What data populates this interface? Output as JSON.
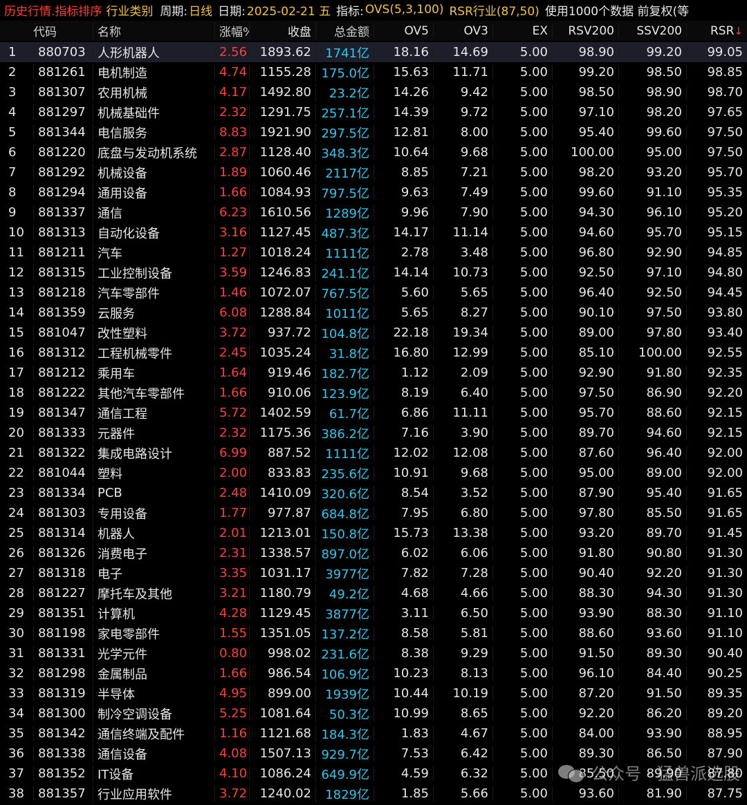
{
  "topbar": {
    "title": "历史行情.指标排序",
    "category": "行业类别",
    "period_label": "周期:",
    "period_value": "日线",
    "date_label": "日期:",
    "date_value": "2025-02-21 五",
    "indicator_label": "指标:",
    "indicator_value": "OVS(5,3,100)",
    "indicator_value2": "RSR行业(87,50)",
    "extra": "使用1000个数据 前复权(等"
  },
  "columns": {
    "code": "代码",
    "name": "名称",
    "change": "涨幅%",
    "close": "收盘",
    "amount": "总金额",
    "ov5": "OV5",
    "ov3": "OV3",
    "ex": "EX",
    "rsv200": "RSV200",
    "ssv200": "SSV200",
    "rsr": "RSR",
    "rsr_sort": "↓"
  },
  "rows": [
    {
      "no": "1",
      "code": "880703",
      "name": "人形机器人",
      "change": "2.56",
      "close": "1893.62",
      "amount": "1741亿",
      "ov5": "18.16",
      "ov3": "14.69",
      "ex": "5.00",
      "rsv": "98.90",
      "ssv": "99.20",
      "rsr": "99.05"
    },
    {
      "no": "2",
      "code": "881261",
      "name": "电机制造",
      "change": "4.74",
      "close": "1155.28",
      "amount": "175.0亿",
      "ov5": "15.63",
      "ov3": "11.71",
      "ex": "5.00",
      "rsv": "99.20",
      "ssv": "98.50",
      "rsr": "98.85"
    },
    {
      "no": "3",
      "code": "881307",
      "name": "农用机械",
      "change": "4.17",
      "close": "1492.80",
      "amount": "23.2亿",
      "ov5": "14.26",
      "ov3": "9.42",
      "ex": "5.00",
      "rsv": "98.50",
      "ssv": "98.90",
      "rsr": "98.70"
    },
    {
      "no": "4",
      "code": "881297",
      "name": "机械基础件",
      "change": "2.32",
      "close": "1291.75",
      "amount": "257.1亿",
      "ov5": "14.39",
      "ov3": "9.72",
      "ex": "5.00",
      "rsv": "97.10",
      "ssv": "98.20",
      "rsr": "97.65"
    },
    {
      "no": "5",
      "code": "881344",
      "name": "电信服务",
      "change": "8.83",
      "close": "1921.90",
      "amount": "297.5亿",
      "ov5": "12.81",
      "ov3": "8.00",
      "ex": "5.00",
      "rsv": "95.40",
      "ssv": "99.60",
      "rsr": "97.50"
    },
    {
      "no": "6",
      "code": "881220",
      "name": "底盘与发动机系统",
      "change": "2.87",
      "close": "1128.40",
      "amount": "348.3亿",
      "ov5": "10.64",
      "ov3": "9.68",
      "ex": "5.00",
      "rsv": "100.00",
      "ssv": "95.00",
      "rsr": "97.50"
    },
    {
      "no": "7",
      "code": "881292",
      "name": "机械设备",
      "change": "1.89",
      "close": "1060.46",
      "amount": "2117亿",
      "ov5": "8.85",
      "ov3": "7.21",
      "ex": "5.00",
      "rsv": "98.20",
      "ssv": "93.20",
      "rsr": "95.70"
    },
    {
      "no": "8",
      "code": "881294",
      "name": "通用设备",
      "change": "1.66",
      "close": "1084.93",
      "amount": "797.5亿",
      "ov5": "9.63",
      "ov3": "7.49",
      "ex": "5.00",
      "rsv": "99.60",
      "ssv": "91.10",
      "rsr": "95.35"
    },
    {
      "no": "9",
      "code": "881337",
      "name": "通信",
      "change": "6.23",
      "close": "1610.56",
      "amount": "1289亿",
      "ov5": "9.96",
      "ov3": "7.90",
      "ex": "5.00",
      "rsv": "94.30",
      "ssv": "96.10",
      "rsr": "95.20"
    },
    {
      "no": "10",
      "code": "881313",
      "name": "自动化设备",
      "change": "3.16",
      "close": "1127.45",
      "amount": "487.3亿",
      "ov5": "14.17",
      "ov3": "11.14",
      "ex": "5.00",
      "rsv": "94.60",
      "ssv": "95.70",
      "rsr": "95.15"
    },
    {
      "no": "11",
      "code": "881211",
      "name": "汽车",
      "change": "1.27",
      "close": "1018.24",
      "amount": "1111亿",
      "ov5": "2.78",
      "ov3": "3.48",
      "ex": "5.00",
      "rsv": "96.80",
      "ssv": "92.90",
      "rsr": "94.85"
    },
    {
      "no": "12",
      "code": "881315",
      "name": "工业控制设备",
      "change": "3.59",
      "close": "1246.83",
      "amount": "241.1亿",
      "ov5": "14.14",
      "ov3": "10.73",
      "ex": "5.00",
      "rsv": "92.50",
      "ssv": "97.10",
      "rsr": "94.80"
    },
    {
      "no": "13",
      "code": "881218",
      "name": "汽车零部件",
      "change": "1.46",
      "close": "1072.07",
      "amount": "767.5亿",
      "ov5": "5.60",
      "ov3": "5.65",
      "ex": "5.00",
      "rsv": "96.40",
      "ssv": "92.50",
      "rsr": "94.45"
    },
    {
      "no": "14",
      "code": "881359",
      "name": "云服务",
      "change": "6.08",
      "close": "1288.84",
      "amount": "1011亿",
      "ov5": "5.65",
      "ov3": "8.27",
      "ex": "5.00",
      "rsv": "90.10",
      "ssv": "97.50",
      "rsr": "93.80"
    },
    {
      "no": "15",
      "code": "881047",
      "name": "改性塑料",
      "change": "3.72",
      "close": "937.72",
      "amount": "104.8亿",
      "ov5": "22.18",
      "ov3": "19.34",
      "ex": "5.00",
      "rsv": "89.00",
      "ssv": "97.80",
      "rsr": "93.40"
    },
    {
      "no": "16",
      "code": "881312",
      "name": "工程机械零件",
      "change": "2.45",
      "close": "1035.24",
      "amount": "31.8亿",
      "ov5": "16.80",
      "ov3": "12.99",
      "ex": "5.00",
      "rsv": "85.10",
      "ssv": "100.00",
      "rsr": "92.55"
    },
    {
      "no": "17",
      "code": "881212",
      "name": "乘用车",
      "change": "1.64",
      "close": "919.46",
      "amount": "182.7亿",
      "ov5": "1.12",
      "ov3": "2.09",
      "ex": "5.00",
      "rsv": "92.90",
      "ssv": "91.80",
      "rsr": "92.35"
    },
    {
      "no": "18",
      "code": "881222",
      "name": "其他汽车零部件",
      "change": "1.66",
      "close": "910.06",
      "amount": "123.9亿",
      "ov5": "8.19",
      "ov3": "6.40",
      "ex": "5.00",
      "rsv": "97.50",
      "ssv": "86.90",
      "rsr": "92.20"
    },
    {
      "no": "19",
      "code": "881347",
      "name": "通信工程",
      "change": "5.72",
      "close": "1402.59",
      "amount": "61.7亿",
      "ov5": "6.86",
      "ov3": "11.11",
      "ex": "5.00",
      "rsv": "95.70",
      "ssv": "88.60",
      "rsr": "92.15"
    },
    {
      "no": "20",
      "code": "881333",
      "name": "元器件",
      "change": "2.32",
      "close": "1175.36",
      "amount": "386.2亿",
      "ov5": "7.16",
      "ov3": "3.90",
      "ex": "5.00",
      "rsv": "89.70",
      "ssv": "94.60",
      "rsr": "92.15"
    },
    {
      "no": "21",
      "code": "881322",
      "name": "集成电路设计",
      "change": "6.99",
      "close": "887.52",
      "amount": "1111亿",
      "ov5": "12.02",
      "ov3": "12.08",
      "ex": "5.00",
      "rsv": "87.60",
      "ssv": "96.40",
      "rsr": "92.00"
    },
    {
      "no": "22",
      "code": "881044",
      "name": "塑料",
      "change": "2.00",
      "close": "833.83",
      "amount": "235.6亿",
      "ov5": "10.91",
      "ov3": "9.68",
      "ex": "5.00",
      "rsv": "95.00",
      "ssv": "89.00",
      "rsr": "92.00"
    },
    {
      "no": "23",
      "code": "881334",
      "name": "PCB",
      "change": "2.48",
      "close": "1410.09",
      "amount": "320.6亿",
      "ov5": "8.54",
      "ov3": "3.52",
      "ex": "5.00",
      "rsv": "87.90",
      "ssv": "95.40",
      "rsr": "91.65"
    },
    {
      "no": "24",
      "code": "881303",
      "name": "专用设备",
      "change": "1.77",
      "close": "977.87",
      "amount": "684.8亿",
      "ov5": "7.95",
      "ov3": "6.80",
      "ex": "5.00",
      "rsv": "97.80",
      "ssv": "85.50",
      "rsr": "91.65"
    },
    {
      "no": "25",
      "code": "881314",
      "name": "机器人",
      "change": "2.01",
      "close": "1213.01",
      "amount": "150.8亿",
      "ov5": "15.73",
      "ov3": "13.38",
      "ex": "5.00",
      "rsv": "93.20",
      "ssv": "89.70",
      "rsr": "91.45"
    },
    {
      "no": "26",
      "code": "881326",
      "name": "消费电子",
      "change": "2.31",
      "close": "1338.57",
      "amount": "897.0亿",
      "ov5": "6.02",
      "ov3": "6.06",
      "ex": "5.00",
      "rsv": "91.80",
      "ssv": "90.80",
      "rsr": "91.30"
    },
    {
      "no": "27",
      "code": "881318",
      "name": "电子",
      "change": "3.35",
      "close": "1031.17",
      "amount": "3977亿",
      "ov5": "7.82",
      "ov3": "7.28",
      "ex": "5.00",
      "rsv": "90.40",
      "ssv": "92.20",
      "rsr": "91.30"
    },
    {
      "no": "28",
      "code": "881227",
      "name": "摩托车及其他",
      "change": "3.21",
      "close": "1180.79",
      "amount": "49.2亿",
      "ov5": "4.68",
      "ov3": "4.66",
      "ex": "5.00",
      "rsv": "88.30",
      "ssv": "94.30",
      "rsr": "91.30"
    },
    {
      "no": "29",
      "code": "881351",
      "name": "计算机",
      "change": "4.28",
      "close": "1129.45",
      "amount": "3877亿",
      "ov5": "3.11",
      "ov3": "6.50",
      "ex": "5.00",
      "rsv": "93.90",
      "ssv": "88.30",
      "rsr": "91.10"
    },
    {
      "no": "30",
      "code": "881198",
      "name": "家电零部件",
      "change": "1.55",
      "close": "1351.05",
      "amount": "137.2亿",
      "ov5": "8.58",
      "ov3": "5.81",
      "ex": "5.00",
      "rsv": "88.60",
      "ssv": "93.60",
      "rsr": "91.10"
    },
    {
      "no": "31",
      "code": "881331",
      "name": "光学元件",
      "change": "0.80",
      "close": "998.02",
      "amount": "231.6亿",
      "ov5": "8.38",
      "ov3": "9.29",
      "ex": "5.00",
      "rsv": "91.50",
      "ssv": "89.30",
      "rsr": "90.40"
    },
    {
      "no": "32",
      "code": "881298",
      "name": "金属制品",
      "change": "1.66",
      "close": "986.54",
      "amount": "106.9亿",
      "ov5": "10.23",
      "ov3": "8.13",
      "ex": "5.00",
      "rsv": "96.10",
      "ssv": "84.40",
      "rsr": "90.25"
    },
    {
      "no": "33",
      "code": "881319",
      "name": "半导体",
      "change": "4.95",
      "close": "899.00",
      "amount": "1939亿",
      "ov5": "10.44",
      "ov3": "10.19",
      "ex": "5.00",
      "rsv": "87.20",
      "ssv": "91.50",
      "rsr": "89.35"
    },
    {
      "no": "34",
      "code": "881300",
      "name": "制冷空调设备",
      "change": "5.25",
      "close": "1081.64",
      "amount": "50.3亿",
      "ov5": "10.99",
      "ov3": "8.65",
      "ex": "5.00",
      "rsv": "92.20",
      "ssv": "86.20",
      "rsr": "89.20"
    },
    {
      "no": "35",
      "code": "881342",
      "name": "通信终端及配件",
      "change": "1.16",
      "close": "1121.68",
      "amount": "184.3亿",
      "ov5": "1.83",
      "ov3": "4.67",
      "ex": "5.00",
      "rsv": "84.00",
      "ssv": "93.90",
      "rsr": "88.95"
    },
    {
      "no": "36",
      "code": "881338",
      "name": "通信设备",
      "change": "4.08",
      "close": "1507.13",
      "amount": "929.7亿",
      "ov5": "7.53",
      "ov3": "6.42",
      "ex": "5.00",
      "rsv": "89.30",
      "ssv": "86.50",
      "rsr": "87.90"
    },
    {
      "no": "37",
      "code": "881352",
      "name": "IT设备",
      "change": "4.10",
      "close": "1086.24",
      "amount": "649.9亿",
      "ov5": "4.59",
      "ov3": "6.32",
      "ex": "5.00",
      "rsv": "85.50",
      "ssv": "89.90",
      "rsr": "87.80"
    },
    {
      "no": "38",
      "code": "881357",
      "name": "行业应用软件",
      "change": "3.72",
      "close": "1240.02",
      "amount": "1829亿",
      "ov5": "1.85",
      "ov3": "5.66",
      "ex": "5.00",
      "rsv": "93.60",
      "ssv": "81.90",
      "rsr": "87.75"
    }
  ],
  "watermark": {
    "text": "公众号 · 猛兽派选股",
    "icon": "wechat-icon"
  },
  "colors": {
    "title": "#ff3b30",
    "accent": "#f2c23c",
    "up": "#ff3b3b",
    "amount": "#27c8f0",
    "background": "#000000",
    "selected_row": "#1c1f2a"
  }
}
